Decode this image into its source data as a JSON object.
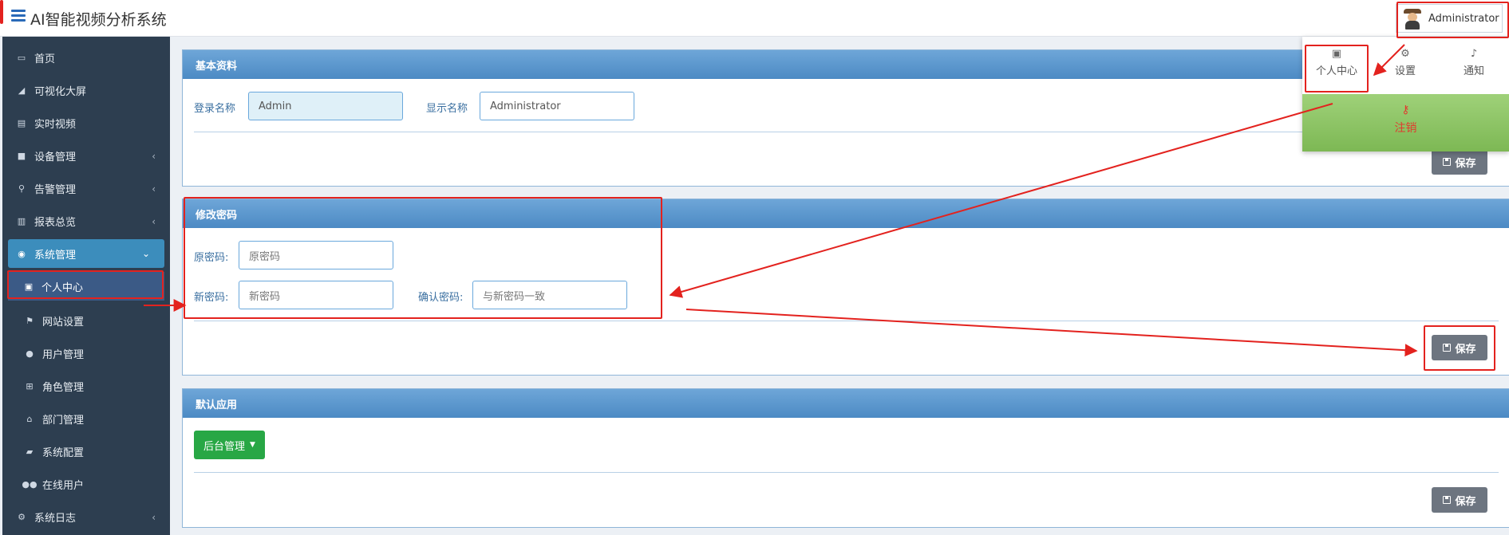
{
  "app": {
    "title": "AI智能视频分析系统"
  },
  "user": {
    "name": "Administrator"
  },
  "sidebar": {
    "items": [
      {
        "label": "首页",
        "icon": "monitor-icon"
      },
      {
        "label": "可视化大屏",
        "icon": "area-chart-icon"
      },
      {
        "label": "实时视频",
        "icon": "film-icon"
      },
      {
        "label": "设备管理",
        "icon": "video-camera-icon",
        "chevron": "‹"
      },
      {
        "label": "告警管理",
        "icon": "search-icon",
        "chevron": "‹"
      },
      {
        "label": "报表总览",
        "icon": "bar-chart-icon",
        "chevron": "‹"
      },
      {
        "label": "系统管理",
        "icon": "user-circle-icon",
        "chevron": "⌄"
      },
      {
        "label": "个人中心",
        "icon": "briefcase-icon"
      },
      {
        "label": "网站设置",
        "icon": "flag-icon"
      },
      {
        "label": "用户管理",
        "icon": "user-icon"
      },
      {
        "label": "角色管理",
        "icon": "sitemap-icon"
      },
      {
        "label": "部门管理",
        "icon": "institution-icon"
      },
      {
        "label": "系统配置",
        "icon": "book-icon"
      },
      {
        "label": "在线用户",
        "icon": "users-icon"
      },
      {
        "label": "系统日志",
        "icon": "cogs-icon",
        "chevron": "‹"
      }
    ]
  },
  "basic": {
    "title": "基本资料",
    "login_label": "登录名称",
    "login_value": "Admin",
    "display_label": "显示名称",
    "display_value": "Administrator",
    "save": "保存"
  },
  "password": {
    "title": "修改密码",
    "old_label": "原密码:",
    "old_placeholder": "原密码",
    "new_label": "新密码:",
    "new_placeholder": "新密码",
    "confirm_label": "确认密码:",
    "confirm_placeholder": "与新密码一致",
    "save": "保存"
  },
  "default_app": {
    "title": "默认应用",
    "selected": "后台管理",
    "save": "保存"
  },
  "dropdown": {
    "profile": "个人中心",
    "settings": "设置",
    "notify": "通知",
    "logout": "注销"
  },
  "colors": {
    "accent": "#3c8dbc",
    "sidebar": "#2d3e50",
    "annotation": "#e3221e",
    "success": "#28a745"
  }
}
